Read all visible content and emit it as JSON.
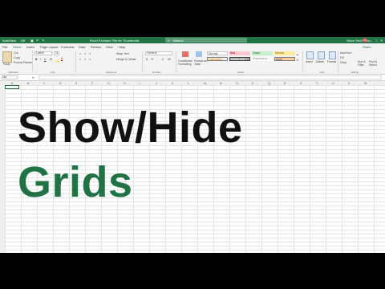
{
  "colors": {
    "excel_green": "#217346",
    "headline_dark": "#111111",
    "headline_green": "#217346"
  },
  "titlebar": {
    "autosave": "AutoSave",
    "autosave_state": "Off",
    "doc_title": "Excel Example File for Thumbnails",
    "search_placeholder": "Search",
    "user": "Steve McDonald",
    "initials": "SM"
  },
  "tabs": [
    "File",
    "Home",
    "Insert",
    "Page Layout",
    "Formulas",
    "Data",
    "Review",
    "View",
    "Help"
  ],
  "active_tab": "Home",
  "share": "Share",
  "ribbon": {
    "clipboard": {
      "paste": "Paste",
      "cut": "Cut",
      "copy": "Copy",
      "format_painter": "Format Painter",
      "group": "Clipboard"
    },
    "font": {
      "name": "Calibri",
      "size": "11",
      "group": "Font"
    },
    "alignment": {
      "wrap": "Wrap Text",
      "merge": "Merge & Center",
      "group": "Alignment"
    },
    "number": {
      "format": "General",
      "group": "Number"
    },
    "styles": {
      "cond": "Conditional Formatting",
      "table": "Format as Table",
      "normal": "Normal",
      "bad": "Bad",
      "good": "Good",
      "neutral": "Neutral",
      "calculation": "Calculation",
      "check_cell": "Check Cell",
      "explanatory": "Explanatory ...",
      "input": "Input",
      "group": "Styles"
    },
    "cells": {
      "insert": "Insert",
      "delete": "Delete",
      "format": "Format",
      "group": "Cells"
    },
    "editing": {
      "autosum": "AutoSum",
      "fill": "Fill",
      "clear": "Clear",
      "sort": "Sort & Filter",
      "find": "Find & Select",
      "group": "Editing"
    }
  },
  "formula_bar": {
    "namebox": "A1",
    "fx": "fx"
  },
  "columns": [
    "A",
    "B",
    "C",
    "D",
    "E",
    "F",
    "G",
    "H",
    "I",
    "J",
    "K",
    "L",
    "M",
    "N",
    "O",
    "P",
    "Q",
    "R",
    "S",
    "T",
    "U",
    "V",
    "W"
  ],
  "headline": {
    "line1": "Show/Hide",
    "line2": "Grids"
  }
}
